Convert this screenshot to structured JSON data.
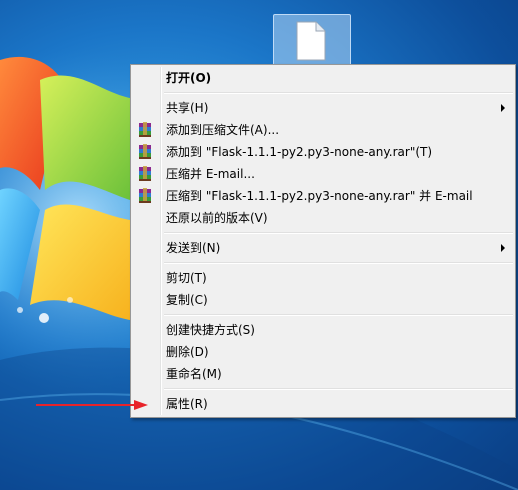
{
  "desktop": {
    "file_icon": "blank-document-icon"
  },
  "context_menu": {
    "items": [
      {
        "label": "打开(O)",
        "bold": true
      },
      {
        "label": "共享(H)",
        "submenu": true
      },
      {
        "label": "添加到压缩文件(A)...",
        "icon": "winrar-icon"
      },
      {
        "label": "添加到 \"Flask-1.1.1-py2.py3-none-any.rar\"(T)",
        "icon": "winrar-icon"
      },
      {
        "label": "压缩并 E-mail...",
        "icon": "winrar-icon"
      },
      {
        "label": "压缩到 \"Flask-1.1.1-py2.py3-none-any.rar\" 并 E-mail",
        "icon": "winrar-icon"
      },
      {
        "label": "还原以前的版本(V)"
      },
      {
        "label": "发送到(N)",
        "submenu": true
      },
      {
        "label": "剪切(T)"
      },
      {
        "label": "复制(C)"
      },
      {
        "label": "创建快捷方式(S)"
      },
      {
        "label": "删除(D)"
      },
      {
        "label": "重命名(M)"
      },
      {
        "label": "属性(R)"
      }
    ]
  },
  "annotation": {
    "arrow_color": "#e8232a"
  }
}
